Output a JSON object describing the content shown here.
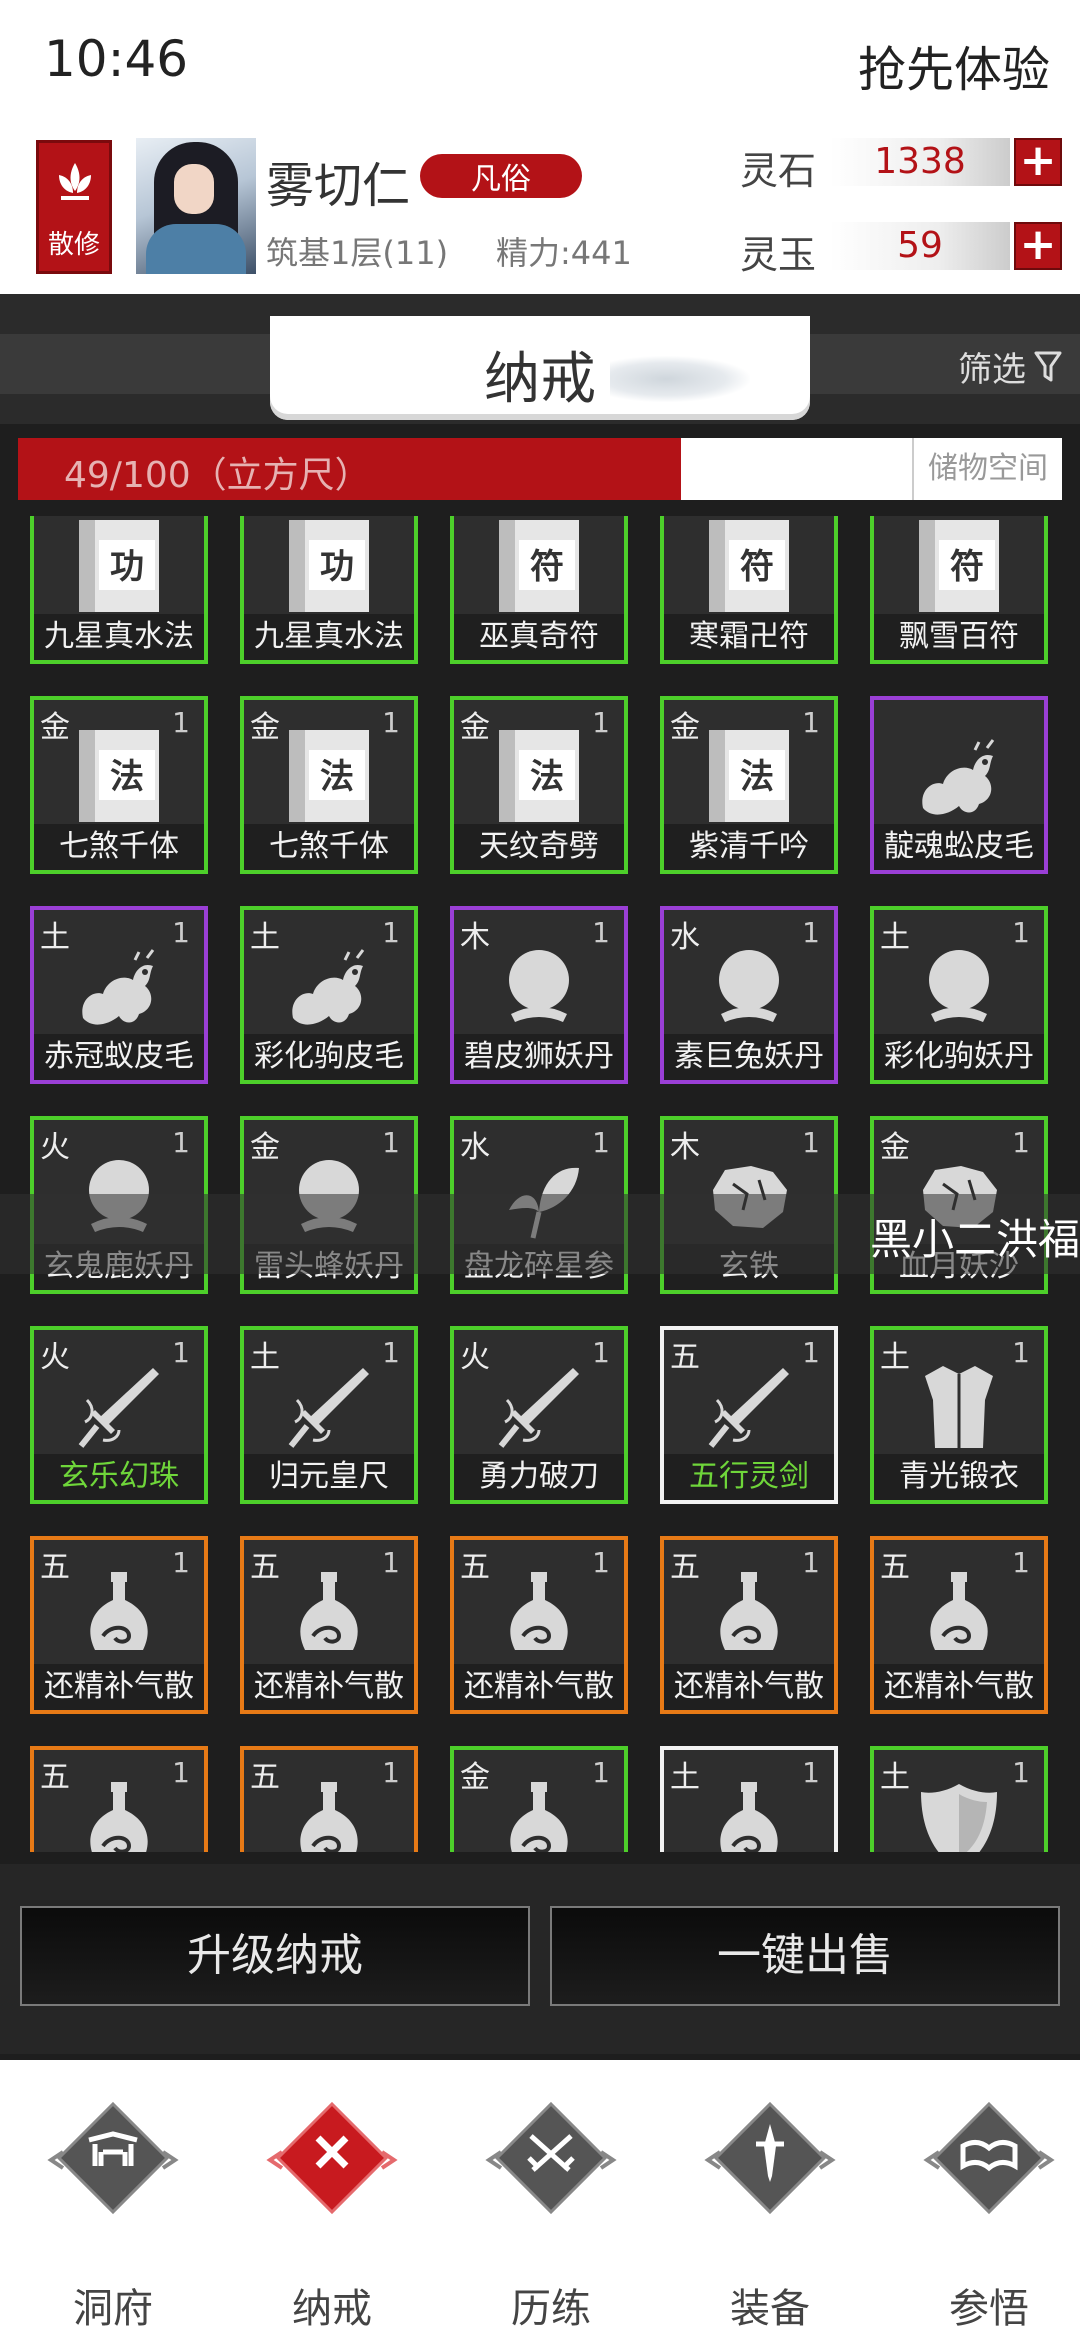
{
  "status_bar": {
    "time": "10:46",
    "right_text": "抢先体验"
  },
  "player": {
    "sect": "散修",
    "name": "雾切仁",
    "rank": "凡俗",
    "realm": "筑基1层(11)",
    "energy": "精力:441"
  },
  "currencies": [
    {
      "label": "灵石",
      "value": "1338"
    },
    {
      "label": "灵玉",
      "value": "59"
    }
  ],
  "title": "纳戒",
  "filter_label": "筛选",
  "capacity": {
    "text": "49/100（立方尺）",
    "fill_fraction": 0.49,
    "storage_label": "储物空间"
  },
  "tip_text": "黑小二洪福",
  "colors": {
    "accent_red": "#b31217",
    "green": "#4dcf2a",
    "purple": "#9a3fd6",
    "orange": "#e77a16",
    "white": "#f2f2f2"
  },
  "items": [
    {
      "elem": "",
      "qty": "",
      "icon": "manual-icon",
      "glyph": "功",
      "name": "九星真水法",
      "quality": "green"
    },
    {
      "elem": "",
      "qty": "",
      "icon": "manual-icon",
      "glyph": "功",
      "name": "九星真水法",
      "quality": "green"
    },
    {
      "elem": "",
      "qty": "",
      "icon": "manual-icon",
      "glyph": "符",
      "name": "巫真奇符",
      "quality": "green"
    },
    {
      "elem": "",
      "qty": "",
      "icon": "manual-icon",
      "glyph": "符",
      "name": "寒霜卍符",
      "quality": "green"
    },
    {
      "elem": "",
      "qty": "",
      "icon": "manual-icon",
      "glyph": "符",
      "name": "飘雪百符",
      "quality": "green"
    },
    {
      "elem": "金",
      "qty": "1",
      "icon": "manual-icon",
      "glyph": "法",
      "name": "七煞千体",
      "quality": "green"
    },
    {
      "elem": "金",
      "qty": "1",
      "icon": "manual-icon",
      "glyph": "法",
      "name": "七煞千体",
      "quality": "green"
    },
    {
      "elem": "金",
      "qty": "1",
      "icon": "manual-icon",
      "glyph": "法",
      "name": "天纹奇劈",
      "quality": "green"
    },
    {
      "elem": "金",
      "qty": "1",
      "icon": "manual-icon",
      "glyph": "法",
      "name": "紫清千吟",
      "quality": "green"
    },
    {
      "elem": "",
      "qty": "",
      "icon": "pelt-icon",
      "glyph": "",
      "name": "靛魂蚣皮毛",
      "quality": "purple"
    },
    {
      "elem": "土",
      "qty": "1",
      "icon": "pelt-icon",
      "glyph": "",
      "name": "赤冠蚁皮毛",
      "quality": "purple"
    },
    {
      "elem": "土",
      "qty": "1",
      "icon": "pelt-icon",
      "glyph": "",
      "name": "彩化驹皮毛",
      "quality": "green"
    },
    {
      "elem": "木",
      "qty": "1",
      "icon": "pill-icon",
      "glyph": "",
      "name": "碧皮狮妖丹",
      "quality": "purple"
    },
    {
      "elem": "水",
      "qty": "1",
      "icon": "pill-icon",
      "glyph": "",
      "name": "素巨兔妖丹",
      "quality": "purple"
    },
    {
      "elem": "土",
      "qty": "1",
      "icon": "pill-icon",
      "glyph": "",
      "name": "彩化驹妖丹",
      "quality": "green"
    },
    {
      "elem": "火",
      "qty": "1",
      "icon": "pill-icon",
      "glyph": "",
      "name": "玄鬼鹿妖丹",
      "quality": "green"
    },
    {
      "elem": "金",
      "qty": "1",
      "icon": "pill-icon",
      "glyph": "",
      "name": "雷头蜂妖丹",
      "quality": "green"
    },
    {
      "elem": "水",
      "qty": "1",
      "icon": "herb-icon",
      "glyph": "",
      "name": "盘龙碎星参",
      "quality": "green"
    },
    {
      "elem": "木",
      "qty": "1",
      "icon": "ore-icon",
      "glyph": "",
      "name": "玄铁",
      "quality": "green"
    },
    {
      "elem": "金",
      "qty": "1",
      "icon": "ore-icon",
      "glyph": "",
      "name": "血月妖沙",
      "quality": "green"
    },
    {
      "elem": "火",
      "qty": "1",
      "icon": "weapon-icon",
      "glyph": "",
      "name": "玄乐幻珠",
      "quality": "green",
      "name_color": "green"
    },
    {
      "elem": "土",
      "qty": "1",
      "icon": "weapon-icon",
      "glyph": "",
      "name": "归元皇尺",
      "quality": "green"
    },
    {
      "elem": "火",
      "qty": "1",
      "icon": "weapon-icon",
      "glyph": "",
      "name": "勇力破刀",
      "quality": "green"
    },
    {
      "elem": "五",
      "qty": "1",
      "icon": "weapon-icon",
      "glyph": "",
      "name": "五行灵剑",
      "quality": "white",
      "name_color": "green"
    },
    {
      "elem": "土",
      "qty": "1",
      "icon": "robe-icon",
      "glyph": "",
      "name": "青光锻衣",
      "quality": "green"
    },
    {
      "elem": "五",
      "qty": "1",
      "icon": "potion-icon",
      "glyph": "",
      "name": "还精补气散",
      "quality": "orange"
    },
    {
      "elem": "五",
      "qty": "1",
      "icon": "potion-icon",
      "glyph": "",
      "name": "还精补气散",
      "quality": "orange"
    },
    {
      "elem": "五",
      "qty": "1",
      "icon": "potion-icon",
      "glyph": "",
      "name": "还精补气散",
      "quality": "orange"
    },
    {
      "elem": "五",
      "qty": "1",
      "icon": "potion-icon",
      "glyph": "",
      "name": "还精补气散",
      "quality": "orange"
    },
    {
      "elem": "五",
      "qty": "1",
      "icon": "potion-icon",
      "glyph": "",
      "name": "还精补气散",
      "quality": "orange"
    },
    {
      "elem": "五",
      "qty": "1",
      "icon": "potion-icon",
      "glyph": "",
      "name": "",
      "quality": "orange"
    },
    {
      "elem": "五",
      "qty": "1",
      "icon": "potion-icon",
      "glyph": "",
      "name": "",
      "quality": "orange"
    },
    {
      "elem": "金",
      "qty": "1",
      "icon": "potion-icon",
      "glyph": "",
      "name": "",
      "quality": "green"
    },
    {
      "elem": "土",
      "qty": "1",
      "icon": "potion-icon",
      "glyph": "",
      "name": "",
      "quality": "white"
    },
    {
      "elem": "土",
      "qty": "1",
      "icon": "shield-icon",
      "glyph": "",
      "name": "",
      "quality": "green"
    }
  ],
  "actions": {
    "upgrade": "升级纳戒",
    "sell_all": "一键出售"
  },
  "nav": [
    {
      "label": "洞府",
      "icon": "gate-icon",
      "active": false
    },
    {
      "label": "纳戒",
      "icon": "ring-icon",
      "active": true
    },
    {
      "label": "历练",
      "icon": "swords-icon",
      "active": false
    },
    {
      "label": "装备",
      "icon": "dagger-icon",
      "active": false
    },
    {
      "label": "参悟",
      "icon": "book-icon",
      "active": false
    }
  ]
}
